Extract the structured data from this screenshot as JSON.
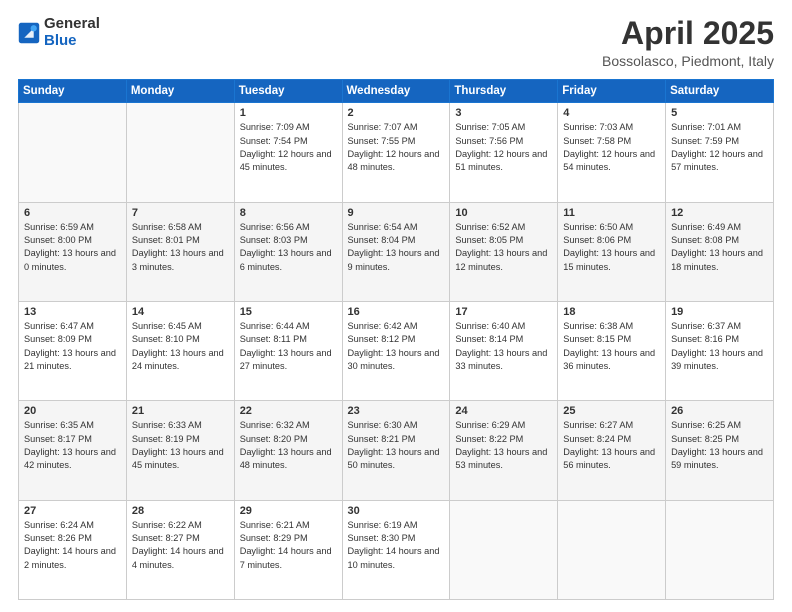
{
  "header": {
    "logo_line1": "General",
    "logo_line2": "Blue",
    "month_title": "April 2025",
    "location": "Bossolasco, Piedmont, Italy"
  },
  "weekdays": [
    "Sunday",
    "Monday",
    "Tuesday",
    "Wednesday",
    "Thursday",
    "Friday",
    "Saturday"
  ],
  "weeks": [
    [
      {
        "day": "",
        "info": ""
      },
      {
        "day": "",
        "info": ""
      },
      {
        "day": "1",
        "info": "Sunrise: 7:09 AM\nSunset: 7:54 PM\nDaylight: 12 hours and 45 minutes."
      },
      {
        "day": "2",
        "info": "Sunrise: 7:07 AM\nSunset: 7:55 PM\nDaylight: 12 hours and 48 minutes."
      },
      {
        "day": "3",
        "info": "Sunrise: 7:05 AM\nSunset: 7:56 PM\nDaylight: 12 hours and 51 minutes."
      },
      {
        "day": "4",
        "info": "Sunrise: 7:03 AM\nSunset: 7:58 PM\nDaylight: 12 hours and 54 minutes."
      },
      {
        "day": "5",
        "info": "Sunrise: 7:01 AM\nSunset: 7:59 PM\nDaylight: 12 hours and 57 minutes."
      }
    ],
    [
      {
        "day": "6",
        "info": "Sunrise: 6:59 AM\nSunset: 8:00 PM\nDaylight: 13 hours and 0 minutes."
      },
      {
        "day": "7",
        "info": "Sunrise: 6:58 AM\nSunset: 8:01 PM\nDaylight: 13 hours and 3 minutes."
      },
      {
        "day": "8",
        "info": "Sunrise: 6:56 AM\nSunset: 8:03 PM\nDaylight: 13 hours and 6 minutes."
      },
      {
        "day": "9",
        "info": "Sunrise: 6:54 AM\nSunset: 8:04 PM\nDaylight: 13 hours and 9 minutes."
      },
      {
        "day": "10",
        "info": "Sunrise: 6:52 AM\nSunset: 8:05 PM\nDaylight: 13 hours and 12 minutes."
      },
      {
        "day": "11",
        "info": "Sunrise: 6:50 AM\nSunset: 8:06 PM\nDaylight: 13 hours and 15 minutes."
      },
      {
        "day": "12",
        "info": "Sunrise: 6:49 AM\nSunset: 8:08 PM\nDaylight: 13 hours and 18 minutes."
      }
    ],
    [
      {
        "day": "13",
        "info": "Sunrise: 6:47 AM\nSunset: 8:09 PM\nDaylight: 13 hours and 21 minutes."
      },
      {
        "day": "14",
        "info": "Sunrise: 6:45 AM\nSunset: 8:10 PM\nDaylight: 13 hours and 24 minutes."
      },
      {
        "day": "15",
        "info": "Sunrise: 6:44 AM\nSunset: 8:11 PM\nDaylight: 13 hours and 27 minutes."
      },
      {
        "day": "16",
        "info": "Sunrise: 6:42 AM\nSunset: 8:12 PM\nDaylight: 13 hours and 30 minutes."
      },
      {
        "day": "17",
        "info": "Sunrise: 6:40 AM\nSunset: 8:14 PM\nDaylight: 13 hours and 33 minutes."
      },
      {
        "day": "18",
        "info": "Sunrise: 6:38 AM\nSunset: 8:15 PM\nDaylight: 13 hours and 36 minutes."
      },
      {
        "day": "19",
        "info": "Sunrise: 6:37 AM\nSunset: 8:16 PM\nDaylight: 13 hours and 39 minutes."
      }
    ],
    [
      {
        "day": "20",
        "info": "Sunrise: 6:35 AM\nSunset: 8:17 PM\nDaylight: 13 hours and 42 minutes."
      },
      {
        "day": "21",
        "info": "Sunrise: 6:33 AM\nSunset: 8:19 PM\nDaylight: 13 hours and 45 minutes."
      },
      {
        "day": "22",
        "info": "Sunrise: 6:32 AM\nSunset: 8:20 PM\nDaylight: 13 hours and 48 minutes."
      },
      {
        "day": "23",
        "info": "Sunrise: 6:30 AM\nSunset: 8:21 PM\nDaylight: 13 hours and 50 minutes."
      },
      {
        "day": "24",
        "info": "Sunrise: 6:29 AM\nSunset: 8:22 PM\nDaylight: 13 hours and 53 minutes."
      },
      {
        "day": "25",
        "info": "Sunrise: 6:27 AM\nSunset: 8:24 PM\nDaylight: 13 hours and 56 minutes."
      },
      {
        "day": "26",
        "info": "Sunrise: 6:25 AM\nSunset: 8:25 PM\nDaylight: 13 hours and 59 minutes."
      }
    ],
    [
      {
        "day": "27",
        "info": "Sunrise: 6:24 AM\nSunset: 8:26 PM\nDaylight: 14 hours and 2 minutes."
      },
      {
        "day": "28",
        "info": "Sunrise: 6:22 AM\nSunset: 8:27 PM\nDaylight: 14 hours and 4 minutes."
      },
      {
        "day": "29",
        "info": "Sunrise: 6:21 AM\nSunset: 8:29 PM\nDaylight: 14 hours and 7 minutes."
      },
      {
        "day": "30",
        "info": "Sunrise: 6:19 AM\nSunset: 8:30 PM\nDaylight: 14 hours and 10 minutes."
      },
      {
        "day": "",
        "info": ""
      },
      {
        "day": "",
        "info": ""
      },
      {
        "day": "",
        "info": ""
      }
    ]
  ]
}
